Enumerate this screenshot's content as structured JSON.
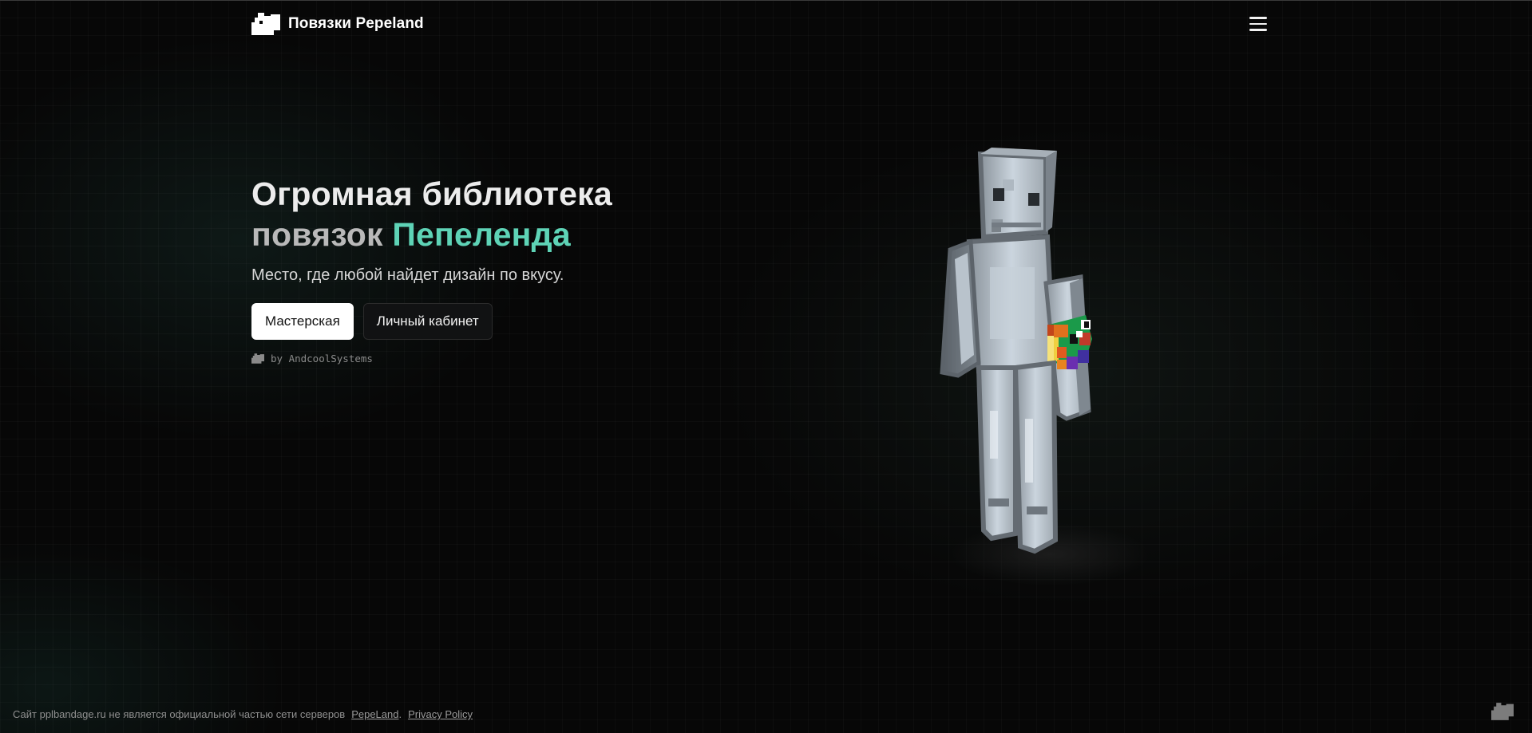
{
  "header": {
    "brand_title": "Повязки Pepeland",
    "menu_icon": "hamburger-menu-icon"
  },
  "hero": {
    "title_line1": "Огромная библиотека",
    "title_line2_prefix": "повязок",
    "title_line2_accent": "Пепеленда",
    "subtitle": "Место, где любой найдет дизайн по вкусу.",
    "primary_button": "Мастерская",
    "secondary_button": "Личный кабинет",
    "byline": "by AndcoolSystems"
  },
  "footer": {
    "disclaimer_prefix": "Сайт pplbandage.ru не является официальной частью сети серверов",
    "pepeland_link": "PepeLand",
    "separator": ".",
    "privacy_link": "Privacy Policy"
  },
  "colors": {
    "background": "#070707",
    "accent": "#5ed3b6",
    "primary_button_bg": "#ffffff",
    "secondary_button_bg": "#111213"
  }
}
